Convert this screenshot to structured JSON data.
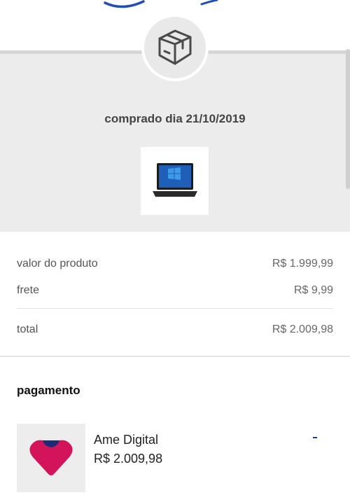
{
  "purchase": {
    "date_label": "comprado dia 21/10/2019"
  },
  "summary": {
    "rows": [
      {
        "label": "valor do produto",
        "value": "R$ 1.999,99"
      },
      {
        "label": "frete",
        "value": "R$ 9,99"
      }
    ],
    "total": {
      "label": "total",
      "value": "R$ 2.009,98"
    }
  },
  "payment": {
    "title": "pagamento",
    "method": "Ame Digital",
    "amount": "R$ 2.009,98"
  },
  "icons": {
    "order_status": "package-box-icon",
    "product": "laptop-thumbnail",
    "payment_logo": "ame-logo-icon"
  },
  "colors": {
    "panel_bg": "#ececec",
    "logo_magenta": "#d4145a",
    "logo_navy": "#1e2a78",
    "accent_blue": "#1e3a8a"
  }
}
